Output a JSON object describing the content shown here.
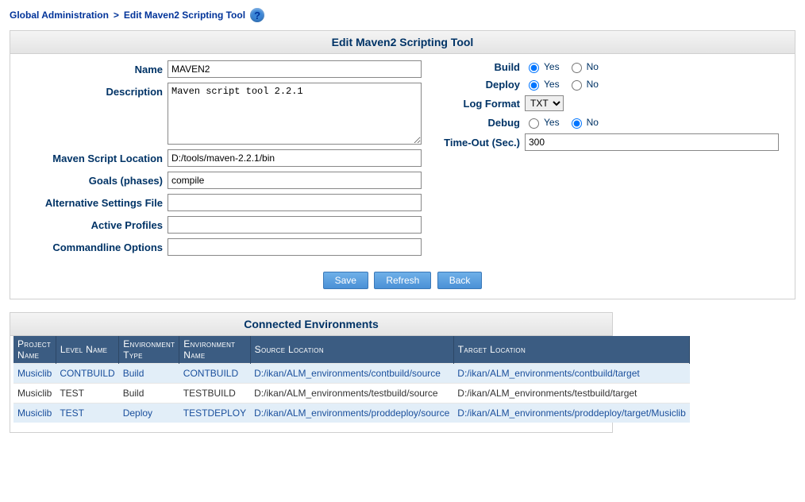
{
  "breadcrumb": {
    "part1": "Global Administration",
    "sep": ">",
    "part2": "Edit Maven2 Scripting Tool"
  },
  "panel_title": "Edit Maven2 Scripting Tool",
  "labels": {
    "name": "Name",
    "description": "Description",
    "mavenScriptLocation": "Maven Script Location",
    "goals": "Goals (phases)",
    "altSettings": "Alternative Settings File",
    "activeProfiles": "Active Profiles",
    "cmdOptions": "Commandline Options",
    "build": "Build",
    "deploy": "Deploy",
    "logFormat": "Log Format",
    "debug": "Debug",
    "timeout": "Time-Out (Sec.)",
    "yes": "Yes",
    "no": "No"
  },
  "values": {
    "name": "MAVEN2",
    "description": "Maven script tool 2.2.1",
    "mavenScriptLocation": "D:/tools/maven-2.2.1/bin",
    "goals": "compile",
    "altSettings": "",
    "activeProfiles": "",
    "cmdOptions": "",
    "logFormat": "TXT",
    "timeout": "300",
    "build": "yes",
    "deploy": "yes",
    "debug": "no"
  },
  "buttons": {
    "save": "Save",
    "refresh": "Refresh",
    "back": "Back"
  },
  "env": {
    "title": "Connected Environments",
    "headers": {
      "project": "Project Name",
      "level": "Level Name",
      "envType": "Environment Type",
      "envName": "Environment Name",
      "source": "Source Location",
      "target": "Target Location"
    },
    "rows": [
      {
        "project": "Musiclib",
        "level": "CONTBUILD",
        "envType": "Build",
        "envName": "CONTBUILD",
        "source": "D:/ikan/ALM_environments/contbuild/source",
        "target": "D:/ikan/ALM_environments/contbuild/target",
        "linked": true
      },
      {
        "project": "Musiclib",
        "level": "TEST",
        "envType": "Build",
        "envName": "TESTBUILD",
        "source": "D:/ikan/ALM_environments/testbuild/source",
        "target": "D:/ikan/ALM_environments/testbuild/target",
        "linked": false
      },
      {
        "project": "Musiclib",
        "level": "TEST",
        "envType": "Deploy",
        "envName": "TESTDEPLOY",
        "source": "D:/ikan/ALM_environments/proddeploy/source",
        "target": "D:/ikan/ALM_environments/proddeploy/target/Musiclib",
        "linked": true
      }
    ]
  }
}
